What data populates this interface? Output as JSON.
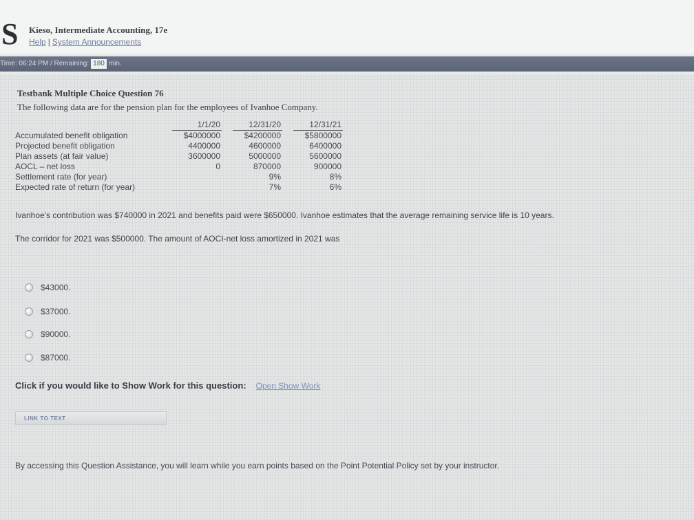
{
  "header": {
    "logo_letter": "S",
    "book_title": "Kieso, Intermediate Accounting, 17e",
    "help_link": "Help",
    "separator": "|",
    "announcements_link": "System Announcements"
  },
  "timebar": {
    "time_label": "Time: 06:24 PM / Remaining:",
    "remaining_value": "180",
    "unit": "min."
  },
  "question": {
    "title": "Testbank Multiple Choice Question 76",
    "intro": "The following data are for the pension plan for the employees of Ivanhoe Company.",
    "table": {
      "headers": [
        "",
        "1/1/20",
        "12/31/20",
        "12/31/21"
      ],
      "rows": [
        [
          "Accumulated benefit obligation",
          "$4000000",
          "$4200000",
          "$5800000"
        ],
        [
          "Projected benefit obligation",
          "4400000",
          "4600000",
          "6400000"
        ],
        [
          "Plan assets (at fair value)",
          "3600000",
          "5000000",
          "5600000"
        ],
        [
          "AOCL – net loss",
          "0",
          "870000",
          "900000"
        ],
        [
          "Settlement rate (for year)",
          "",
          "9%",
          "8%"
        ],
        [
          "Expected rate of return (for year)",
          "",
          "7%",
          "6%"
        ]
      ]
    },
    "paragraph1": "Ivanhoe's contribution was $740000 in 2021 and benefits paid were $650000. Ivanhoe estimates that the average remaining service life is 10 years.",
    "paragraph2": "The corridor for 2021 was $500000. The amount of AOCI-net loss amortized in 2021 was",
    "options": [
      "$43000.",
      "$37000.",
      "$90000.",
      "$87000."
    ]
  },
  "show_work": {
    "prompt": "Click if you would like to Show Work for this question:",
    "link": "Open Show Work"
  },
  "link_to_text": "LINK TO TEXT",
  "footer": "By accessing this Question Assistance, you will learn while you earn points based on the Point Potential Policy set by your instructor."
}
